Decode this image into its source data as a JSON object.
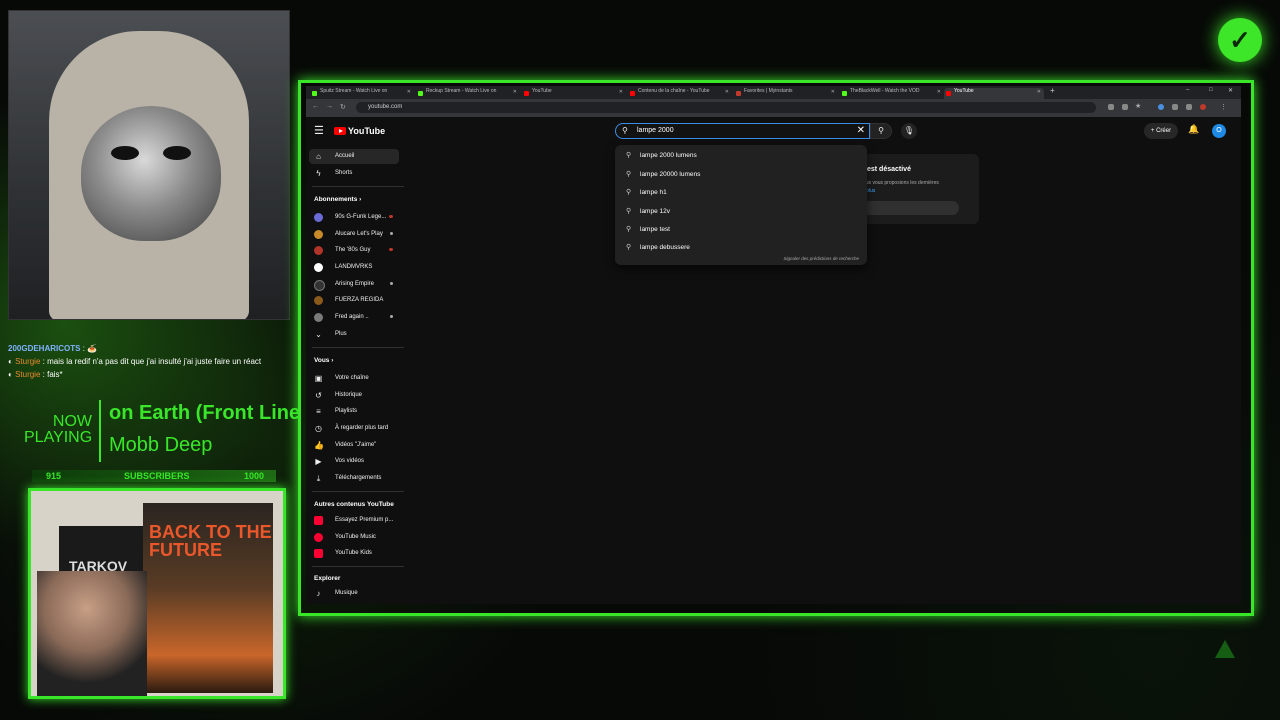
{
  "overlay": {
    "chat": [
      {
        "user": "200GDEHARICOTS",
        "message": "🍝"
      },
      {
        "user": "Sturgie",
        "message": "mais la redif n'a pas dit que j'ai insulté j'ai juste faire un réact"
      },
      {
        "user": "Sturgie",
        "message": "fais*"
      }
    ],
    "now_playing": {
      "label": "NOW PLAYING",
      "song": "on Earth (Front Line",
      "artist": "Mobb Deep"
    },
    "subscribers": {
      "current": "915",
      "label": "SUBSCRIBERS",
      "goal": "1000"
    },
    "poster_title": "BACK TO THE FUTURE",
    "dark_photo_text": "TARKOV",
    "colors": {
      "accent": "#39e62a",
      "background": "#070907"
    }
  },
  "browser": {
    "tabs": [
      {
        "title": "Spuitz Stream - Watch Live on",
        "color": "#53fc18",
        "active": false
      },
      {
        "title": "Reckup Stream - Watch Live on",
        "color": "#53fc18",
        "active": false
      },
      {
        "title": "YouTube",
        "color": "#ff0000",
        "active": false
      },
      {
        "title": "Contenu de la chaîne - YouTube",
        "color": "#ff0000",
        "active": false
      },
      {
        "title": "Favorites | Myinstants",
        "color": "#c0392b",
        "active": false
      },
      {
        "title": "TheBlackWell - Watch the VOD",
        "color": "#53fc18",
        "active": false
      },
      {
        "title": "YouTube",
        "color": "#ff0000",
        "active": true
      }
    ],
    "new_tab": "+",
    "window_controls": [
      "–",
      "□",
      "✕"
    ],
    "url": "youtube.com"
  },
  "youtube": {
    "logo_text": "YouTube",
    "search": {
      "value": "lampe 2000",
      "clear": "✕"
    },
    "create_label": "Créer",
    "avatar_letter": "O",
    "suggestions": [
      {
        "text": "lampe 2000 lumens"
      },
      {
        "text": "lampe 20000 lumens"
      },
      {
        "text": "lampe h1"
      },
      {
        "text": "lampe 12v"
      },
      {
        "text": "lampe test"
      },
      {
        "text": "lampe debussere"
      }
    ],
    "report_link": "Signaler des prédictions de recherche",
    "history_card": {
      "title": "est désactivé",
      "text": "ous vous proposions les dernières",
      "link": "r plus"
    },
    "sidebar": {
      "main": [
        {
          "label": "Accueil",
          "icon": "⌂",
          "active": true
        },
        {
          "label": "Shorts",
          "icon": "ϟ",
          "active": false
        }
      ],
      "subscriptions_title": "Abonnements",
      "subscriptions": [
        {
          "label": "90s G-Funk Lege...",
          "color": "#6b6bd6",
          "dot": "red"
        },
        {
          "label": "Alucare Let's Play",
          "color": "#c98a2a",
          "dot": "grey"
        },
        {
          "label": "The '80s Guy",
          "color": "#b0342a",
          "dot": "red"
        },
        {
          "label": "LANDMVRKS",
          "color": "#ffffff",
          "dot": "none"
        },
        {
          "label": "Arising Empire",
          "color": "#333333",
          "dot": "grey"
        },
        {
          "label": "FUERZA REGIDA",
          "color": "#8a5a1a",
          "dot": "none"
        },
        {
          "label": "Fred again ..",
          "color": "#7a7a7a",
          "dot": "grey"
        }
      ],
      "more_label": "Plus",
      "you_title": "Vous",
      "you": [
        {
          "label": "Votre chaîne",
          "icon": "▣"
        },
        {
          "label": "Historique",
          "icon": "↺"
        },
        {
          "label": "Playlists",
          "icon": "≡"
        },
        {
          "label": "À regarder plus tard",
          "icon": "◷"
        },
        {
          "label": "Vidéos \"J'aime\"",
          "icon": "👍"
        },
        {
          "label": "Vos vidéos",
          "icon": "▶"
        },
        {
          "label": "Téléchargements",
          "icon": "⤓"
        }
      ],
      "other_title": "Autres contenus YouTube",
      "other": [
        {
          "label": "Essayez Premium p...",
          "color": "#ff0033"
        },
        {
          "label": "YouTube Music",
          "color": "#ff0033"
        },
        {
          "label": "YouTube Kids",
          "color": "#ff0033"
        }
      ],
      "explore_title": "Explorer",
      "explore": [
        {
          "label": "Musique",
          "icon": "♪"
        }
      ]
    }
  }
}
